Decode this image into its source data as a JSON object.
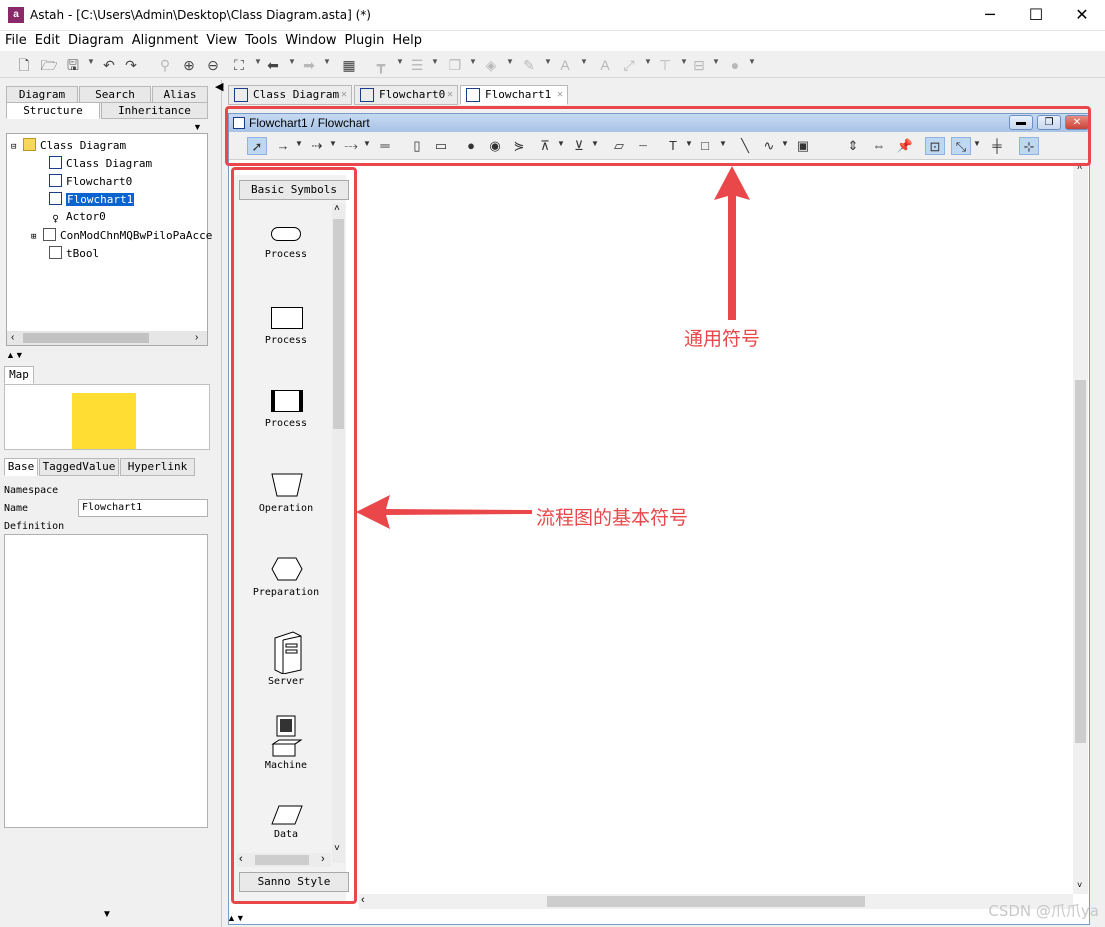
{
  "window": {
    "title": "Astah - [C:\\Users\\Admin\\Desktop\\Class Diagram.asta] (*)",
    "app_icon_text": "a",
    "minimize": "─",
    "maximize": "☐",
    "close": "✕"
  },
  "menu": [
    "File",
    "Edit",
    "Diagram",
    "Alignment",
    "View",
    "Tools",
    "Window",
    "Plugin",
    "Help"
  ],
  "left": {
    "tabs_row1": [
      "Diagram",
      "Search",
      "Alias"
    ],
    "tabs_row2": [
      "Structure",
      "Inheritance"
    ],
    "tree": [
      {
        "label": "Class Diagram",
        "icon": "package-icon"
      },
      {
        "label": "Class Diagram",
        "icon": "class-diagram-icon"
      },
      {
        "label": "Flowchart0",
        "icon": "flowchart-icon"
      },
      {
        "label": "Flowchart1",
        "icon": "flowchart-icon"
      },
      {
        "label": "Actor0",
        "icon": "actor-icon"
      },
      {
        "label": "ConModChnMQBwPiloPaAcce",
        "icon": "class-icon"
      },
      {
        "label": "tBool",
        "icon": "class-icon"
      }
    ],
    "map_tab": "Map",
    "props_tabs": [
      "Base",
      "TaggedValue",
      "Hyperlink"
    ],
    "namespace_label": "Namespace",
    "name_label": "Name",
    "name_value": "Flowchart1",
    "definition_label": "Definition"
  },
  "doc_tabs": [
    "Class Diagram",
    "Flowchart0",
    "Flowchart1"
  ],
  "inner": {
    "title": "Flowchart1 / Flowchart"
  },
  "palette": {
    "header": "Basic Symbols",
    "items": [
      "Process",
      "Process",
      "Process",
      "Operation",
      "Preparation",
      "Server",
      "Machine",
      "Data"
    ],
    "footer": "Sanno Style"
  },
  "annotations": {
    "toolbar_note": "通用符号",
    "palette_note": "流程图的基本符号"
  },
  "watermark": "CSDN @爪爪ya",
  "colors": {
    "annotation_red": "#e9474a",
    "map_yellow": "#ffdd33",
    "tree_selected": "#0a64d0"
  }
}
